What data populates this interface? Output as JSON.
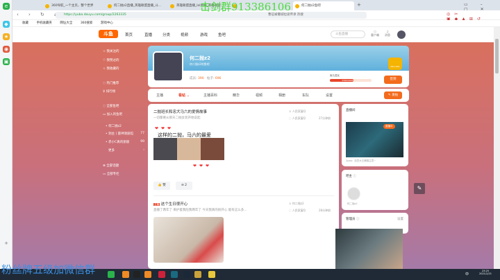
{
  "watermarks": {
    "top": "击剑群913386106",
    "bottom": "粉丝牌五级加微信群"
  },
  "browser": {
    "tabs": [
      "360导航_一个主页，整个世界",
      "何二抛z2直播_英雄联盟直播_斗...",
      "英雄联盟直播_lol直播_英雄联盟...",
      "",
      "何二抛z2鱼吧"
    ],
    "url": "https://yuba.douyu.com/group/2263335",
    "search": "曹征被撤城拉圾传承 热搜",
    "bookmarks": [
      "收藏",
      "手机收藏夹",
      "网址大全",
      "360搜索",
      "游戏中心"
    ]
  },
  "header": {
    "logo": "斗鱼",
    "nav": [
      "首页",
      "直播",
      "分类",
      "视频",
      "游戏",
      "鱼吧"
    ],
    "search_placeholder": "斗鱼直播",
    "icons": [
      "客户端",
      "消息"
    ]
  },
  "sidebar": {
    "items": [
      "我关注的",
      "我赞过的",
      "我收藏的",
      "热门推荐",
      "排行榜",
      "全部鱼吧",
      "加入的鱼吧"
    ],
    "groups": [
      {
        "name": "何二抛z2",
        "count": ""
      },
      {
        "name": "洞主丨雷神洞丽馆",
        "count": "77"
      },
      {
        "name": "赤小C真的丽丽",
        "count": "99"
      }
    ],
    "more": "更多",
    "bottom": [
      "全部话题",
      "全部专栏"
    ]
  },
  "group": {
    "name": "何二抛z2",
    "subtitle": "何二抛z2的鱼吧",
    "members_label": "成员:",
    "members": "390",
    "posts_label": "帖子:",
    "posts": "696",
    "level_name": "鱼丸居民",
    "progress_text": "5586/9999",
    "progress": 0.56,
    "level_badge": "NO.1991",
    "signin": "签到"
  },
  "tabs": {
    "items": [
      "主播",
      "看帖",
      "主播百科",
      "精华",
      "视频",
      "相册",
      "车队",
      "设置"
    ],
    "active": 1,
    "post_button": "发帖"
  },
  "posts": [
    {
      "title": "二抛班长和忠犬马六的爱情故事",
      "summary": "一切都要从那天二抛女装开始说起",
      "author": "人民家宴Q",
      "replier": "人民家宴Q",
      "time": "27分钟前",
      "caption": "这样的二抛，马六的最爱",
      "likes": "赞",
      "comments": "2"
    },
    {
      "tag": "主播",
      "title": "这个生日很开心",
      "summary": "直播了两年了 来护着我陪我两年了 今天我真的很开心 能有这么多...",
      "author": "何二抛z2",
      "replier": "人民家宴Q",
      "time": "28分钟前"
    }
  ],
  "right": {
    "live_title": "直播间",
    "live_badge": "直播中",
    "live_caption": "2pao：自豆大王蛋糕主意~",
    "owner_title": "吧主",
    "owner_name": "何二抛z2",
    "admin_title": "管理员",
    "admin_action": "设置"
  },
  "taskbar": {
    "time": "23:25",
    "date": "2021/2/21",
    "ime": "中"
  }
}
